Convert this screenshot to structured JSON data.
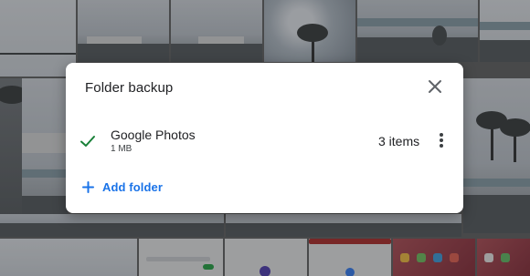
{
  "dialog": {
    "title": "Folder backup",
    "close_icon": "close-icon",
    "folders": [
      {
        "name": "Google Photos",
        "size": "1 MB",
        "count": "3 items",
        "status_icon": "check-icon",
        "menu_icon": "more-vert-icon"
      }
    ],
    "add_folder_label": "Add folder",
    "add_icon": "plus-icon"
  },
  "colors": {
    "accent": "#1a73e8",
    "check": "#188038",
    "text_primary": "#202124",
    "icon": "#3c4043"
  }
}
